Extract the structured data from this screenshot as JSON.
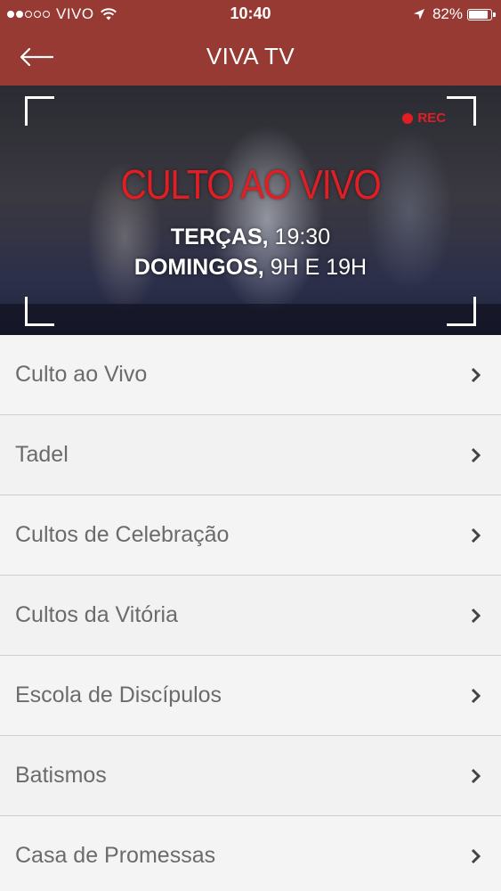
{
  "status_bar": {
    "carrier": "VIVO",
    "time": "10:40",
    "battery_percent": "82%",
    "signal_bars_filled": 2,
    "signal_bars_total": 5
  },
  "nav": {
    "title": "VIVA TV"
  },
  "hero": {
    "rec_label": "REC",
    "title": "CULTO AO VIVO",
    "line1_bold": "TERÇAS,",
    "line1_rest": " 19:30",
    "line2_bold": "DOMINGOS,",
    "line2_rest": " 9H E 19H"
  },
  "menu": {
    "items": [
      {
        "label": "Culto ao Vivo"
      },
      {
        "label": "Tadel"
      },
      {
        "label": "Cultos de Celebração"
      },
      {
        "label": "Cultos da Vitória"
      },
      {
        "label": "Escola de Discípulos"
      },
      {
        "label": "Batismos"
      },
      {
        "label": "Casa de Promessas"
      }
    ]
  },
  "colors": {
    "brand": "#973a33",
    "accent_red": "#e01e24",
    "list_text": "#6b6b6b"
  },
  "icons": [
    "signal-icon",
    "wifi-icon",
    "location-arrow-icon",
    "battery-icon",
    "back-arrow-icon",
    "rec-dot-icon",
    "chevron-right-icon"
  ]
}
